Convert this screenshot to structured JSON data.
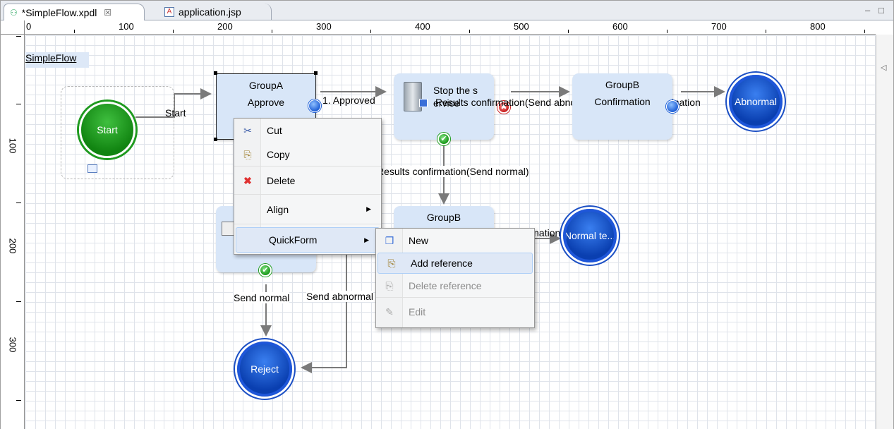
{
  "tabs": [
    {
      "label": "*SimpleFlow.xpdl",
      "icon": "xpdl-file-icon"
    },
    {
      "label": "application.jsp",
      "icon": "jsp-file-icon"
    }
  ],
  "ruler": {
    "top_labels": [
      "100",
      "200",
      "300",
      "400",
      "500",
      "600",
      "700",
      "800"
    ],
    "left_labels": [
      "100",
      "200",
      "300"
    ]
  },
  "diagram": {
    "flow_name": "SimpleFlow",
    "start_label": "Start",
    "start_edge_label": "Start",
    "groupA": {
      "title": "GroupA",
      "subtitle": "Approve"
    },
    "approved_label": "1. Approved",
    "stop_node": {
      "title": "Stop the s",
      "sub": "ervice"
    },
    "results_abnormal_label": "Results confirmation(Send abnormal) - Abnormal termination",
    "groupB_top": {
      "title": "GroupB",
      "subtitle": "Confirmation"
    },
    "abnormal_end_label": "Abnormal",
    "results_normal_label": "Results confirmation(Send normal)",
    "groupB_mid": {
      "title": "GroupB"
    },
    "normal_term_edge_label": "Normal termination",
    "normal_end_label": "Normal te...",
    "send_normal_label": "Send normal",
    "send_abnormal_label": "Send abnormal",
    "reject_label": "Reject"
  },
  "context_menu": {
    "items": [
      {
        "label": "Cut",
        "icon": "scissors-icon"
      },
      {
        "label": "Copy",
        "icon": "copy-icon"
      },
      {
        "label": "Delete",
        "icon": "delete-x-icon"
      },
      {
        "label": "Align",
        "icon": ""
      },
      {
        "label": "QuickForm",
        "icon": ""
      }
    ]
  },
  "submenu": {
    "items": [
      {
        "label": "New",
        "icon": "new-form-icon"
      },
      {
        "label": "Add reference",
        "icon": "add-reference-icon"
      },
      {
        "label": "Delete reference",
        "icon": "delete-reference-icon"
      },
      {
        "label": "Edit",
        "icon": "edit-icon"
      }
    ]
  },
  "colors": {
    "node_fill": "#d8e6f8",
    "accent_blue": "#1e56d8",
    "start_green": "#1f9a1f"
  }
}
